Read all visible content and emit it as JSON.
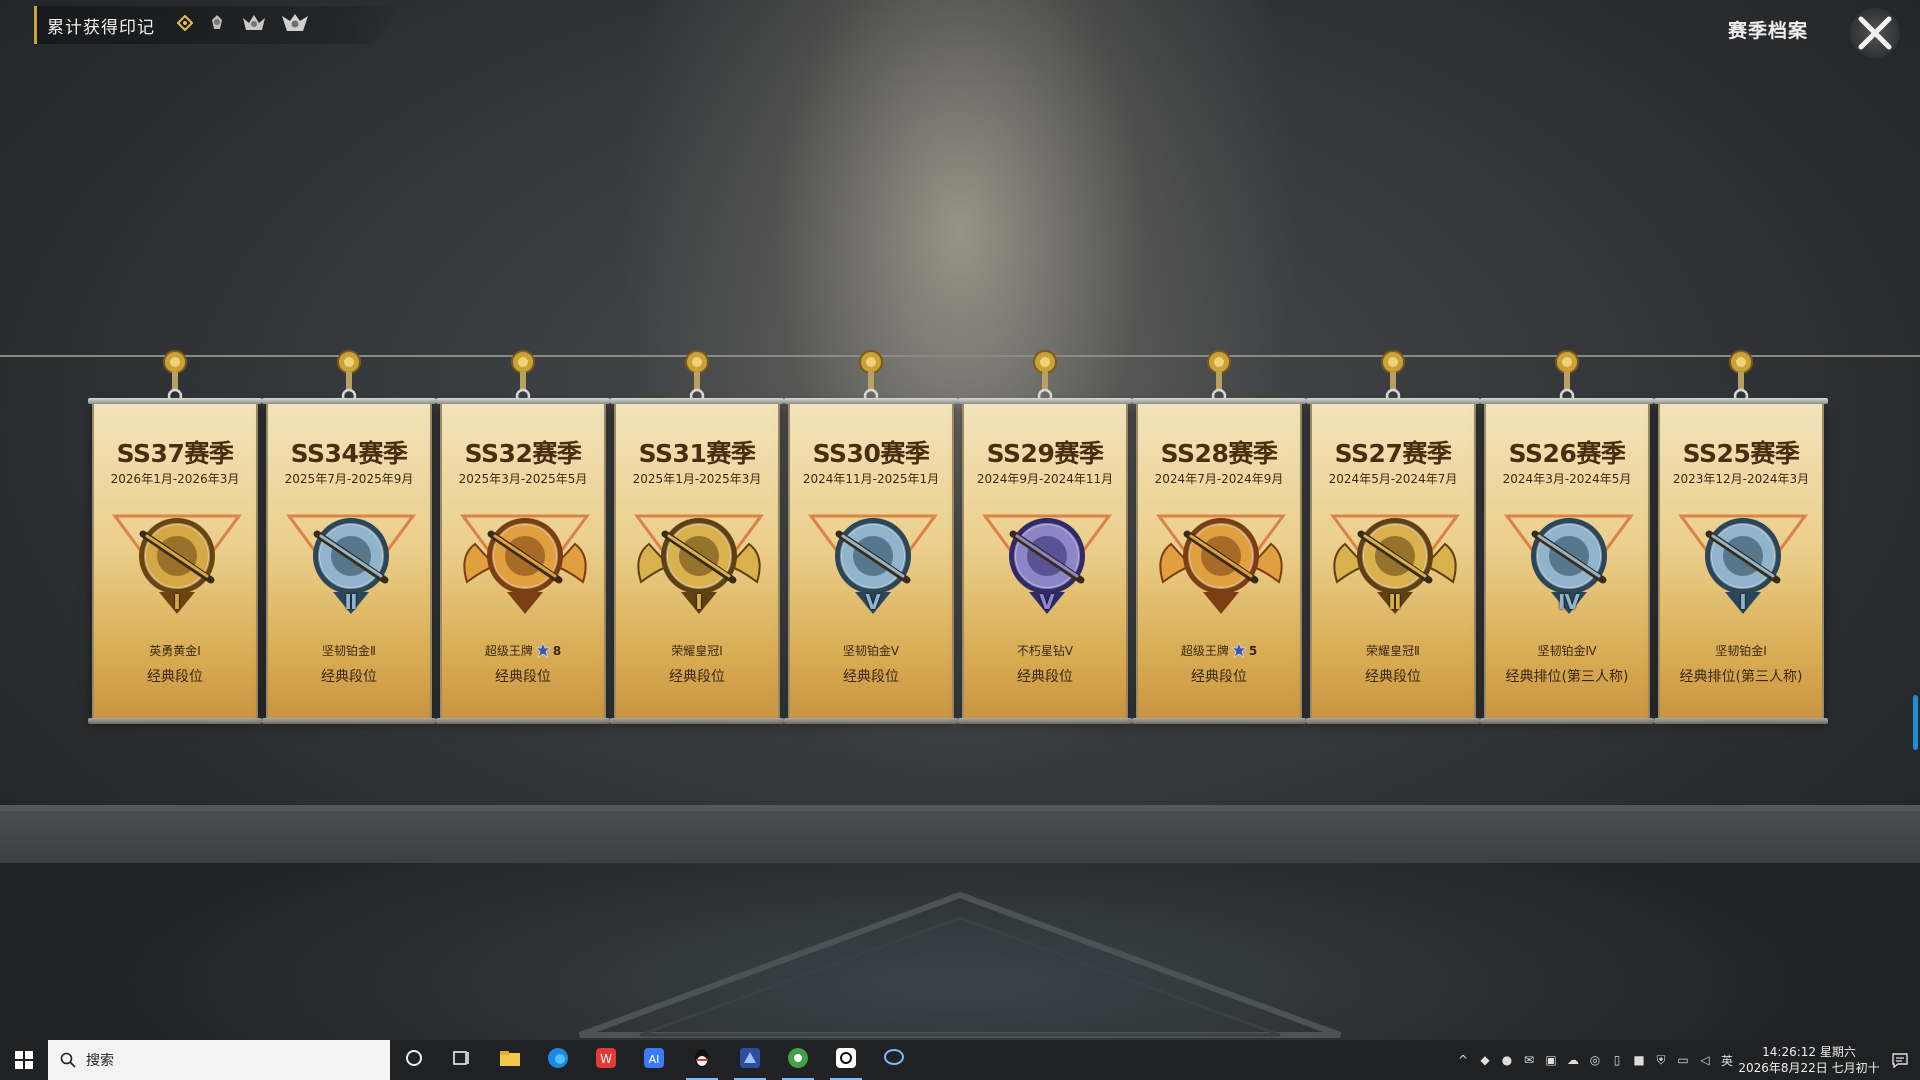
{
  "header": {
    "achievement_label": "累计获得印记",
    "title": "赛季档案",
    "close_icon": "close-icon"
  },
  "banners": [
    {
      "season": "SS37赛季",
      "dates": "2026年1月-2026年3月",
      "tier": "英勇黄金Ⅰ",
      "mode": "经典段位",
      "emblem": "gold-rifle-emblem",
      "numeral": "Ⅰ",
      "metal": "#d6a845",
      "dark": "#6a4410"
    },
    {
      "season": "SS34赛季",
      "dates": "2025年7月-2025年9月",
      "tier": "坚韧铂金Ⅱ",
      "mode": "经典段位",
      "emblem": "platinum-smg-emblem",
      "numeral": "Ⅱ",
      "metal": "#8fb4cc",
      "dark": "#2a4658"
    },
    {
      "season": "SS32赛季",
      "dates": "2025年3月-2025年5月",
      "tier": "超级王牌",
      "tier_stars": "8",
      "mode": "经典段位",
      "emblem": "ace-winged-emblem",
      "numeral": "",
      "metal": "#e0a040",
      "dark": "#7a3e12"
    },
    {
      "season": "SS31赛季",
      "dates": "2025年1月-2025年3月",
      "tier": "荣耀皇冠Ⅰ",
      "mode": "经典段位",
      "emblem": "crown-winged-emblem",
      "numeral": "Ⅰ",
      "metal": "#d9b24e",
      "dark": "#5e4012"
    },
    {
      "season": "SS30赛季",
      "dates": "2024年11月-2025年1月",
      "tier": "坚韧铂金Ⅴ",
      "mode": "经典段位",
      "emblem": "platinum-smg-emblem",
      "numeral": "Ⅴ",
      "metal": "#8fb4cc",
      "dark": "#2a4658"
    },
    {
      "season": "SS29赛季",
      "dates": "2024年9月-2024年11月",
      "tier": "不朽星钻Ⅴ",
      "mode": "经典段位",
      "emblem": "diamond-emblem",
      "numeral": "Ⅴ",
      "metal": "#8c86c8",
      "dark": "#302a68"
    },
    {
      "season": "SS28赛季",
      "dates": "2024年7月-2024年9月",
      "tier": "超级王牌",
      "tier_stars": "5",
      "mode": "经典段位",
      "emblem": "ace-winged-emblem",
      "numeral": "",
      "metal": "#e0a040",
      "dark": "#7a3e12"
    },
    {
      "season": "SS27赛季",
      "dates": "2024年5月-2024年7月",
      "tier": "荣耀皇冠Ⅱ",
      "mode": "经典段位",
      "emblem": "crown-winged-emblem",
      "numeral": "Ⅱ",
      "metal": "#d9b24e",
      "dark": "#5e4012"
    },
    {
      "season": "SS26赛季",
      "dates": "2024年3月-2024年5月",
      "tier": "坚韧铂金Ⅳ",
      "mode": "经典排位(第三人称)",
      "emblem": "platinum-smg-emblem",
      "numeral": "Ⅳ",
      "metal": "#8fb4cc",
      "dark": "#2a4658"
    },
    {
      "season": "SS25赛季",
      "dates": "2023年12月-2024年3月",
      "tier": "坚韧铂金Ⅰ",
      "mode": "经典排位(第三人称)",
      "emblem": "platinum-smg-emblem",
      "numeral": "Ⅰ",
      "metal": "#8fb4cc",
      "dark": "#2a4658"
    }
  ],
  "taskbar": {
    "search_placeholder": "搜索",
    "apps": [
      "cortana-icon",
      "task-view-icon",
      "file-explorer-icon",
      "edge-icon",
      "wps-icon",
      "ai-icon",
      "qq-icon",
      "game-launcher-icon",
      "green-app-icon",
      "chatgpt-icon",
      "chat-bubble-icon"
    ],
    "ime": "英",
    "time": "14:26:12 星期六",
    "date": "2026年8月22日 七月初十"
  },
  "colors": {
    "accent": "#c9a23a",
    "banner_gold": "#ebcf8c",
    "scroll": "#1d8fd6"
  }
}
